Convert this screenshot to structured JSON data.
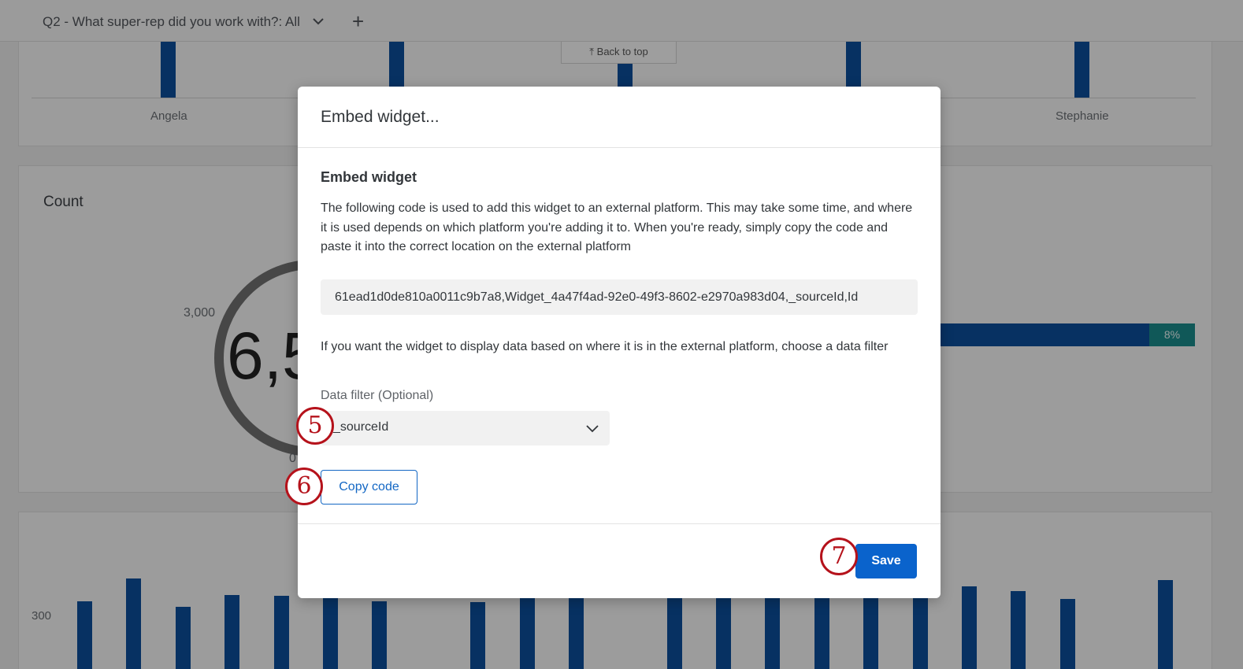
{
  "filter_bar": {
    "label": "Q2 - What super-rep did you work with?: All",
    "chevron_icon": "chevron-down-icon",
    "add_icon": "plus-icon",
    "add_glyph": "+"
  },
  "back_to_top": "⤒ Back to top",
  "top_chart": {
    "labels": [
      "Angela",
      "Stephanie"
    ]
  },
  "count_widget": {
    "title": "Count",
    "tick_3000": "3,000",
    "tick_0": "0",
    "value_visible": "6,5"
  },
  "hbar_widget": {
    "percent": "8%"
  },
  "bottom_chart": {
    "y_tick": "300"
  },
  "modal": {
    "title": "Embed widget...",
    "section_title": "Embed widget",
    "description": "The following code is used to add this widget to an external platform. This may take some time, and where it is used depends on which platform you're adding it to. When you're ready, simply copy the code and paste it into the correct location on the external platform",
    "code": "61ead1d0de810a0011c9b7a8,Widget_4a47f4ad-92e0-49f3-8602-e2970a983d04,_sourceId,Id",
    "filter_description": "If you want the widget to display data based on where it is in the external platform, choose a data filter",
    "filter_label": "Data filter (Optional)",
    "filter_value": "_sourceId",
    "copy_button": "Copy code",
    "save_button": "Save"
  },
  "steps": {
    "step5": "5",
    "step6": "6",
    "step7": "7"
  },
  "colors": {
    "bar_blue": "#0b4e9a",
    "teal": "#1a8a8a",
    "primary": "#0a63cc",
    "step_red": "#b5121b"
  }
}
